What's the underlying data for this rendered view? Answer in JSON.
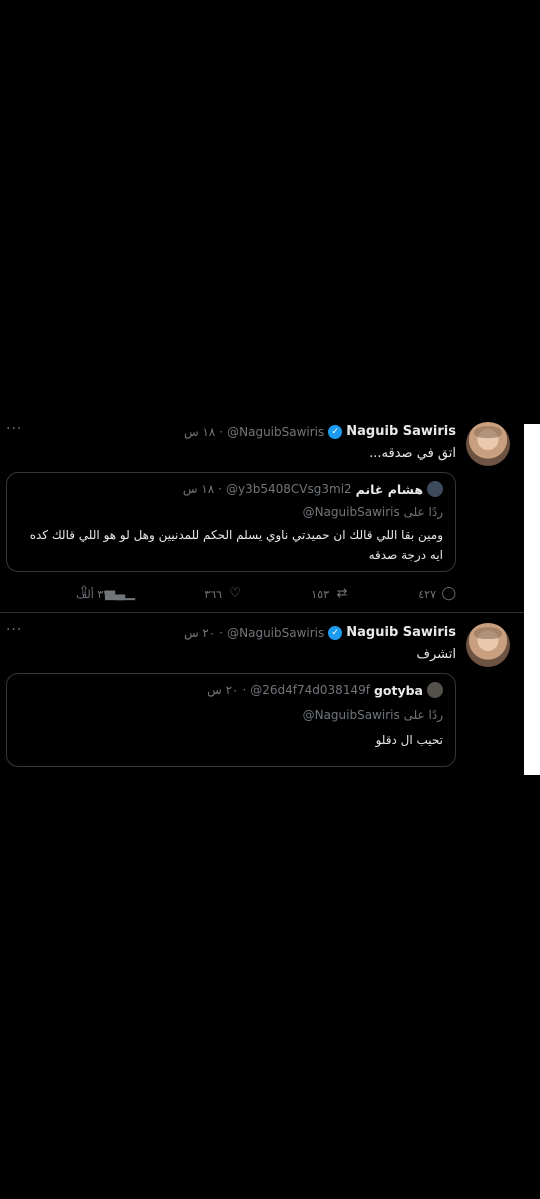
{
  "tweets": [
    {
      "author_name": "Naguib Sawiris",
      "handle": "@NaguibSawiris",
      "time": "١٨ س",
      "text": "اتق في صدقه...",
      "quote": {
        "author_name": "هشام غانم",
        "handle": "@y3b5408CVsg3mi2",
        "time": "١٨ س",
        "reply_prefix": "ردًا على",
        "reply_to": "@NaguibSawiris",
        "text": "ومين بقا اللي قالك ان حميدتي ناوي يسلم الحكم للمدنيين وهل لو هو اللي قالك كده ايه درجة صدقه"
      },
      "stats": {
        "replies": "٤٢٧",
        "retweets": "١٥٣",
        "likes": "٣٦٦",
        "views": "٣٣٧ ألف"
      }
    },
    {
      "author_name": "Naguib Sawiris",
      "handle": "@NaguibSawiris",
      "time": "٢٠ س",
      "text": "اتشرف",
      "quote": {
        "author_name": "gotyba",
        "handle": "@26d4f74d038149f",
        "time": "٢٠ س",
        "reply_prefix": "ردًا على",
        "reply_to": "@NaguibSawiris",
        "text": "تحيب ال دقلو"
      }
    }
  ],
  "separator": "·",
  "more_label": "···",
  "icons": {
    "verified": "verified-badge-icon",
    "reply": "reply-icon",
    "retweet": "retweet-icon",
    "like": "heart-icon",
    "views": "views-icon",
    "share": "share-icon"
  },
  "colors": {
    "background": "#000000",
    "text": "#e7e9ea",
    "muted": "#71767b",
    "verified": "#1d9bf0",
    "border": "#333639"
  }
}
